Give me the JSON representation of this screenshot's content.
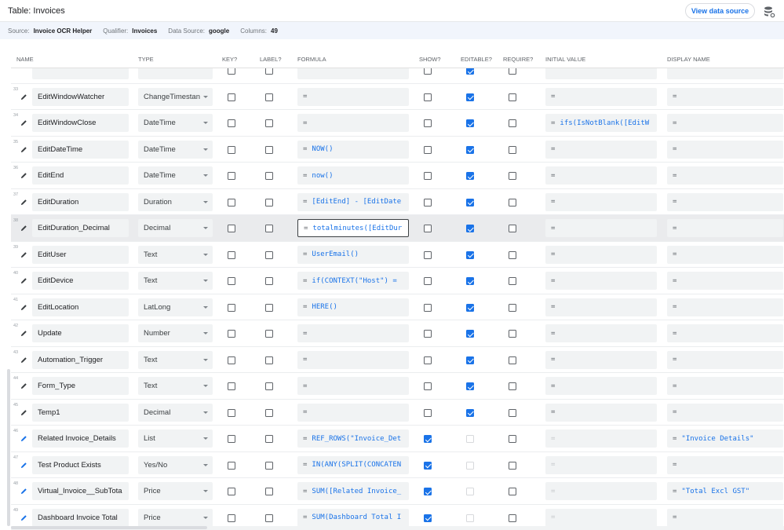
{
  "title": "Table: Invoices",
  "view_data_source_label": "View data source",
  "settings_icon": "database-settings-icon",
  "info": {
    "source_label": "Source:",
    "source": "Invoice OCR Helper",
    "qualifier_label": "Qualifier:",
    "qualifier": "Invoices",
    "datasource_label": "Data Source:",
    "datasource": "google",
    "columns_label": "Columns:",
    "columns": "49"
  },
  "headers": {
    "name": "NAME",
    "type": "TYPE",
    "key": "KEY?",
    "label": "LABEL?",
    "formula": "FORMULA",
    "show": "SHOW?",
    "editable": "EDITABLE?",
    "require": "REQUIRE?",
    "initial": "INITIAL VALUE",
    "display": "DISPLAY NAME"
  },
  "partial_row": {
    "editable": true
  },
  "rows": [
    {
      "num": "33",
      "name": "EditWindowWatcher",
      "type": "ChangeTimestan",
      "key": false,
      "label": false,
      "formula": "",
      "show": false,
      "editable": true,
      "editable_disabled": false,
      "require": false,
      "initial": "",
      "display": "",
      "virtual": false,
      "selected": false
    },
    {
      "num": "34",
      "name": "EditWindowClose",
      "type": "DateTime",
      "key": false,
      "label": false,
      "formula": "",
      "show": false,
      "editable": true,
      "editable_disabled": false,
      "require": false,
      "initial": "ifs(IsNotBlank([EditW",
      "display": "",
      "virtual": false,
      "selected": false
    },
    {
      "num": "35",
      "name": "EditDateTime",
      "type": "DateTime",
      "key": false,
      "label": false,
      "formula": "NOW()",
      "show": false,
      "editable": true,
      "editable_disabled": false,
      "require": false,
      "initial": "",
      "display": "",
      "virtual": false,
      "selected": false
    },
    {
      "num": "36",
      "name": "EditEnd",
      "type": "DateTime",
      "key": false,
      "label": false,
      "formula": "now()",
      "show": false,
      "editable": true,
      "editable_disabled": false,
      "require": false,
      "initial": "",
      "display": "",
      "virtual": false,
      "selected": false
    },
    {
      "num": "37",
      "name": "EditDuration",
      "type": "Duration",
      "key": false,
      "label": false,
      "formula": "[EditEnd] - [EditDate",
      "show": false,
      "editable": true,
      "editable_disabled": false,
      "require": false,
      "initial": "",
      "display": "",
      "virtual": false,
      "selected": false
    },
    {
      "num": "38",
      "name": "EditDuration_Decimal",
      "type": "Decimal",
      "key": false,
      "label": false,
      "formula": "totalminutes([EditDur",
      "show": false,
      "editable": true,
      "editable_disabled": false,
      "require": false,
      "initial": "",
      "display": "",
      "virtual": false,
      "selected": true
    },
    {
      "num": "39",
      "name": "EditUser",
      "type": "Text",
      "key": false,
      "label": false,
      "formula": "UserEmail()",
      "show": false,
      "editable": true,
      "editable_disabled": false,
      "require": false,
      "initial": "",
      "display": "",
      "virtual": false,
      "selected": false
    },
    {
      "num": "40",
      "name": "EditDevice",
      "type": "Text",
      "key": false,
      "label": false,
      "formula": "if(CONTEXT(\"Host\") =",
      "show": false,
      "editable": true,
      "editable_disabled": false,
      "require": false,
      "initial": "",
      "display": "",
      "virtual": false,
      "selected": false
    },
    {
      "num": "41",
      "name": "EditLocation",
      "type": "LatLong",
      "key": false,
      "label": false,
      "formula": "HERE()",
      "show": false,
      "editable": true,
      "editable_disabled": false,
      "require": false,
      "initial": "",
      "display": "",
      "virtual": false,
      "selected": false
    },
    {
      "num": "42",
      "name": "Update",
      "type": "Number",
      "key": false,
      "label": false,
      "formula": "",
      "show": false,
      "editable": true,
      "editable_disabled": false,
      "require": false,
      "initial": "",
      "display": "",
      "virtual": false,
      "selected": false
    },
    {
      "num": "43",
      "name": "Automation_Trigger",
      "type": "Text",
      "key": false,
      "label": false,
      "formula": "",
      "show": false,
      "editable": true,
      "editable_disabled": false,
      "require": false,
      "initial": "",
      "display": "",
      "virtual": false,
      "selected": false
    },
    {
      "num": "44",
      "name": "Form_Type",
      "type": "Text",
      "key": false,
      "label": false,
      "formula": "",
      "show": false,
      "editable": true,
      "editable_disabled": false,
      "require": false,
      "initial": "",
      "display": "",
      "virtual": false,
      "selected": false
    },
    {
      "num": "45",
      "name": "Temp1",
      "type": "Decimal",
      "key": false,
      "label": false,
      "formula": "",
      "show": false,
      "editable": true,
      "editable_disabled": false,
      "require": false,
      "initial": "",
      "display": "",
      "virtual": false,
      "selected": false
    },
    {
      "num": "46",
      "name": "Related Invoice_Details",
      "type": "List",
      "key": false,
      "label": false,
      "formula": "REF_ROWS(\"Invoice_Det",
      "show": true,
      "editable": false,
      "editable_disabled": true,
      "require": false,
      "initial": "",
      "display": "\"Invoice Details\"",
      "virtual": true,
      "selected": false
    },
    {
      "num": "47",
      "name": "Test Product Exists",
      "type": "Yes/No",
      "key": false,
      "label": false,
      "formula": "IN(ANY(SPLIT(CONCATEN",
      "show": true,
      "editable": false,
      "editable_disabled": true,
      "require": false,
      "initial": "",
      "display": "",
      "virtual": true,
      "selected": false
    },
    {
      "num": "48",
      "name": "Virtual_Invoice__SubTota",
      "type": "Price",
      "key": false,
      "label": false,
      "formula": "SUM([Related Invoice_",
      "show": true,
      "editable": false,
      "editable_disabled": true,
      "require": false,
      "initial": "",
      "display": "\"Total Excl GST\"",
      "virtual": true,
      "selected": false
    },
    {
      "num": "49",
      "name": "Dashboard Invoice Total",
      "type": "Price",
      "key": false,
      "label": false,
      "formula": "SUM(Dashboard Total I",
      "show": true,
      "editable": false,
      "editable_disabled": true,
      "require": false,
      "initial": "",
      "display": "",
      "virtual": true,
      "selected": false
    }
  ],
  "colors": {
    "accent": "#1a73e8",
    "field_bg": "#f1f3f4",
    "info_bg": "#f1f5fc"
  }
}
